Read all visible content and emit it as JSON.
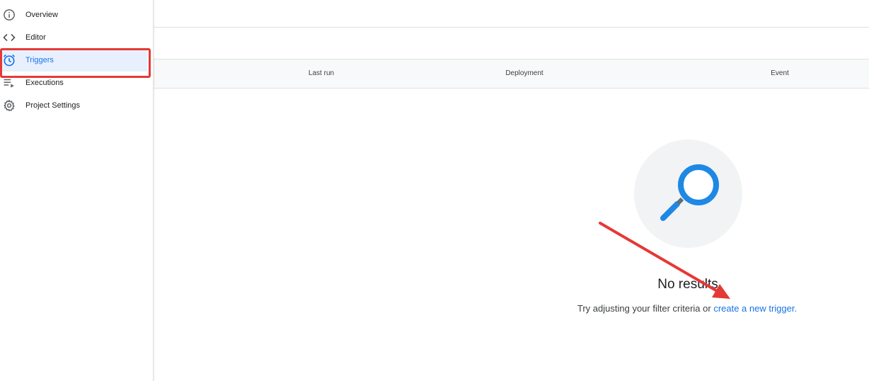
{
  "sidebar": {
    "items": [
      {
        "label": "Overview",
        "icon": "info-icon"
      },
      {
        "label": "Editor",
        "icon": "code-icon"
      },
      {
        "label": "Triggers",
        "icon": "alarm-icon",
        "active": true
      },
      {
        "label": "Executions",
        "icon": "executions-icon"
      },
      {
        "label": "Project Settings",
        "icon": "gear-icon"
      }
    ]
  },
  "table": {
    "columns": [
      "Last run",
      "Deployment",
      "Event"
    ]
  },
  "empty_state": {
    "title": "No results",
    "hint_prefix": "Try adjusting your filter criteria or ",
    "hint_link": "create a new trigger."
  },
  "colors": {
    "accent": "#1a73e8",
    "annotation": "#e53935",
    "search_icon": "#1e88e5"
  }
}
